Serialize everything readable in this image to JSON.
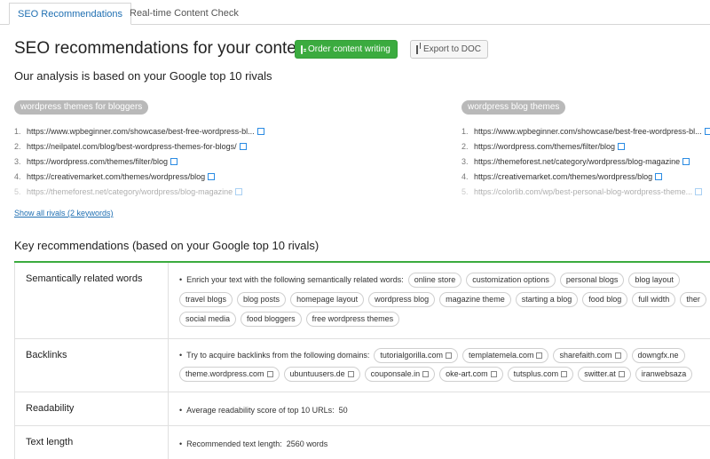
{
  "tabs": [
    {
      "label": "SEO Recommendations"
    },
    {
      "label": "Real-time Content Check"
    }
  ],
  "header": {
    "title": "SEO recommendations for your content",
    "order_label": "Order content writing",
    "export_label": "Export to DOC"
  },
  "analysis": {
    "subtitle": "Our analysis is based on your Google top 10 rivals",
    "show_all": "Show all rivals (2 keywords)",
    "keywords": [
      {
        "keyword": "wordpress themes for bloggers",
        "urls": [
          "https://www.wpbeginner.com/showcase/best-free-wordpress-bl...",
          "https://neilpatel.com/blog/best-wordpress-themes-for-blogs/",
          "https://wordpress.com/themes/filter/blog",
          "https://creativemarket.com/themes/wordpress/blog",
          "https://themeforest.net/category/wordpress/blog-magazine"
        ]
      },
      {
        "keyword": "wordpress blog themes",
        "urls": [
          "https://www.wpbeginner.com/showcase/best-free-wordpress-bl...",
          "https://wordpress.com/themes/filter/blog",
          "https://themeforest.net/category/wordpress/blog-magazine",
          "https://creativemarket.com/themes/wordpress/blog",
          "https://colorlib.com/wp/best-personal-blog-wordpress-theme..."
        ]
      }
    ]
  },
  "recommendations": {
    "title": "Key recommendations (based on your Google top 10 rivals)",
    "semantic": {
      "label": "Semantically related words",
      "text": "Enrich your text with the following semantically related words:",
      "words": [
        "online store",
        "customization options",
        "personal blogs",
        "blog layout",
        "travel blogs",
        "blog posts",
        "homepage layout",
        "wordpress blog",
        "magazine theme",
        "starting a blog",
        "food blog",
        "full width",
        "ther",
        "social media",
        "food bloggers",
        "free wordpress themes"
      ]
    },
    "backlinks": {
      "label": "Backlinks",
      "text": "Try to acquire backlinks from the following domains:",
      "domains": [
        "tutorialgorilla.com",
        "templatemela.com",
        "sharefaith.com",
        "downgfx.ne",
        "theme.wordpress.com",
        "ubuntuusers.de",
        "couponsale.in",
        "oke-art.com",
        "tutsplus.com",
        "switter.at",
        "iranwebsaza"
      ]
    },
    "readability": {
      "label": "Readability",
      "text": "Average readability score of top 10 URLs:",
      "value": "50"
    },
    "length": {
      "label": "Text length",
      "text": "Recommended text length:",
      "value": "2560 words"
    }
  }
}
